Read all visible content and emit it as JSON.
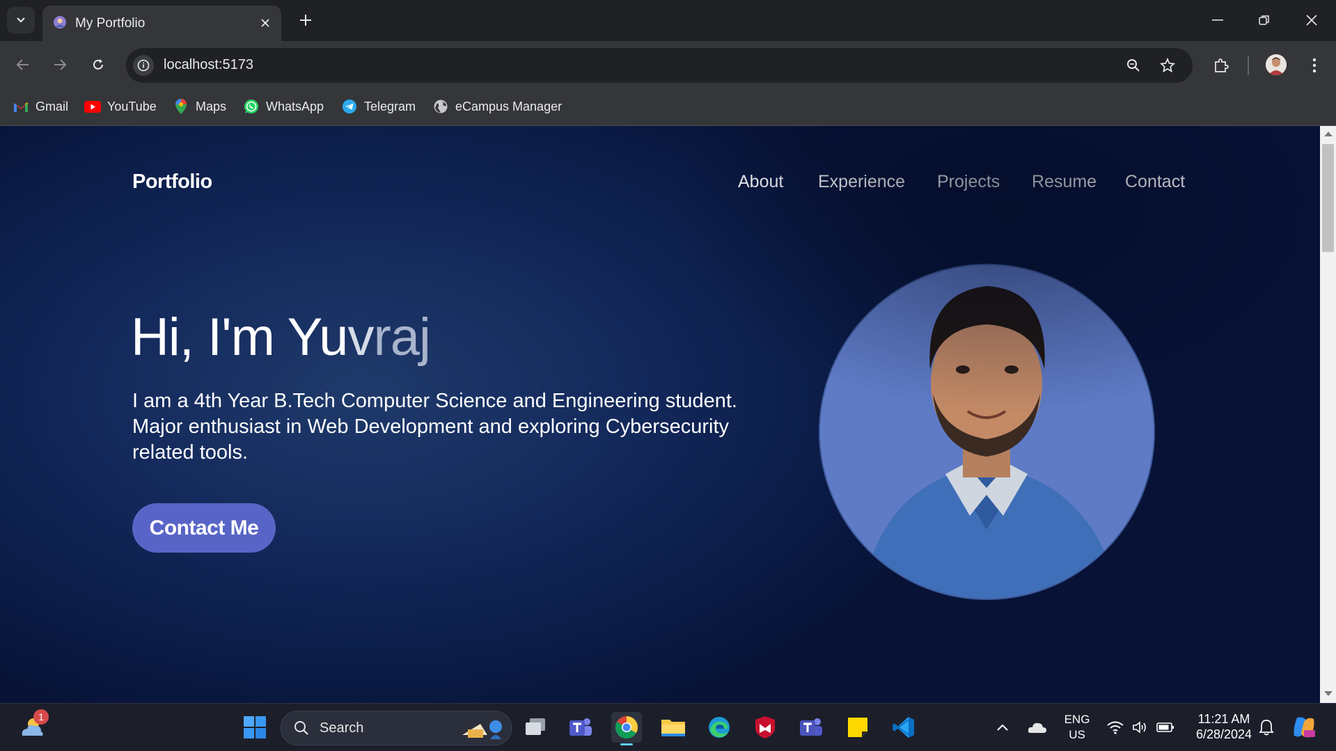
{
  "browser": {
    "tab_title": "My Portfolio",
    "url": "localhost:5173",
    "bookmarks": [
      {
        "label": "Gmail",
        "icon": "gmail-icon"
      },
      {
        "label": "YouTube",
        "icon": "youtube-icon"
      },
      {
        "label": "Maps",
        "icon": "maps-icon"
      },
      {
        "label": "WhatsApp",
        "icon": "whatsapp-icon"
      },
      {
        "label": "Telegram",
        "icon": "telegram-icon"
      },
      {
        "label": "eCampus Manager",
        "icon": "globe-icon"
      }
    ]
  },
  "page": {
    "logo": "Portfolio",
    "nav": [
      "About",
      "Experience",
      "Projects",
      "Resume",
      "Contact"
    ],
    "hero": {
      "title_main": "Hi, I'm Yu",
      "title_fade1": "v",
      "title_fade2": "raj",
      "description": "I am a 4th Year B.Tech Computer Science and Engineering student. Major enthusiast in Web Development and exploring Cybersecurity related tools.",
      "cta": "Contact Me"
    }
  },
  "taskbar": {
    "search_label": "Search",
    "weather_badge": "1",
    "lang_top": "ENG",
    "lang_bottom": "US",
    "time": "11:21 AM",
    "date": "6/28/2024"
  },
  "colors": {
    "accent_button": "#5865c7",
    "page_bg": "#0b1c47",
    "photo_bg": "#5f7bc6"
  }
}
